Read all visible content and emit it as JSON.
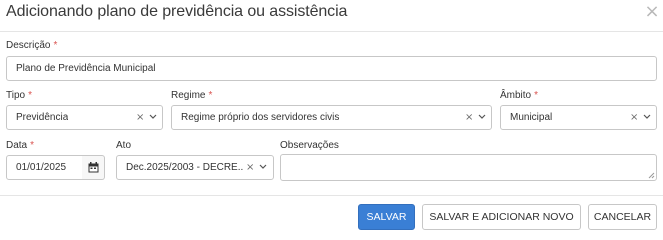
{
  "dialog": {
    "title": "Adicionando plano de previdência ou assistência",
    "close_icon": "×"
  },
  "form": {
    "required_mark": "*",
    "descricao": {
      "label": "Descrição",
      "value": "Plano de Previdência Municipal"
    },
    "tipo": {
      "label": "Tipo",
      "value": "Previdência"
    },
    "regime": {
      "label": "Regime",
      "value": "Regime próprio dos servidores civis"
    },
    "ambito": {
      "label": "Âmbito",
      "value": "Municipal"
    },
    "data": {
      "label": "Data",
      "value": "01/01/2025"
    },
    "ato": {
      "label": "Ato",
      "value": "Dec.2025/2003 - DECRE..."
    },
    "observacoes": {
      "label": "Observações",
      "value": ""
    },
    "clear_icon": "×"
  },
  "footer": {
    "save": "SALVAR",
    "save_new": "SALVAR E ADICIONAR NOVO",
    "cancel": "CANCELAR"
  },
  "colors": {
    "primary": "#3a7fd5",
    "required": "#d9534f",
    "border": "#c7c7c7"
  },
  "icons": {
    "close": "close-icon",
    "clear": "clear-icon",
    "dropdown": "chevron-down-icon",
    "calendar": "calendar-icon",
    "resize": "resize-grip-icon"
  }
}
